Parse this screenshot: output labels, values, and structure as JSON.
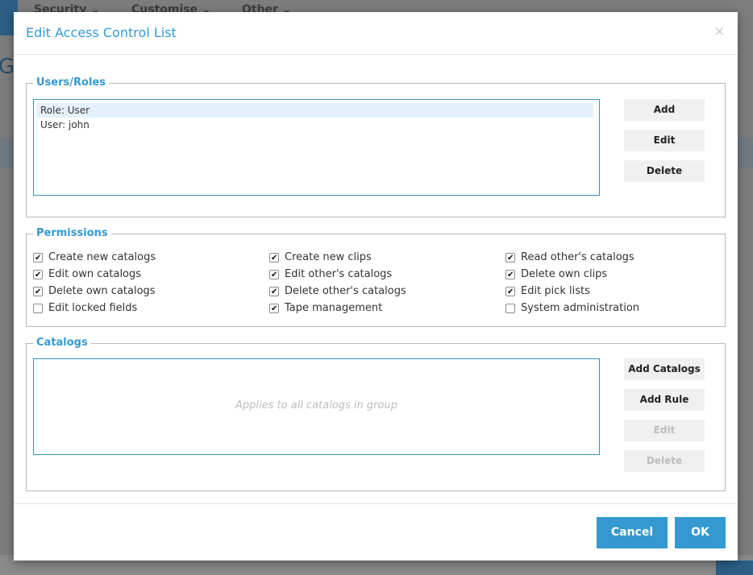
{
  "background": {
    "nav_items": [
      "Security",
      "Customise",
      "Other"
    ],
    "partial_title": "G"
  },
  "dialog": {
    "title": "Edit Access Control List",
    "close_glyph": "×"
  },
  "users_roles": {
    "legend": "Users/Roles",
    "items": [
      "Role: User",
      "User: john"
    ],
    "buttons": {
      "add": "Add",
      "edit": "Edit",
      "delete": "Delete"
    }
  },
  "permissions": {
    "legend": "Permissions",
    "items": [
      {
        "label": "Create new catalogs",
        "checked": true
      },
      {
        "label": "Edit own catalogs",
        "checked": true
      },
      {
        "label": "Delete own catalogs",
        "checked": true
      },
      {
        "label": "Edit locked fields",
        "checked": false
      },
      {
        "label": "Create new clips",
        "checked": true
      },
      {
        "label": "Edit other's catalogs",
        "checked": true
      },
      {
        "label": "Delete other's catalogs",
        "checked": true
      },
      {
        "label": "Tape management",
        "checked": true
      },
      {
        "label": "Read other's catalogs",
        "checked": true
      },
      {
        "label": "Delete own clips",
        "checked": true
      },
      {
        "label": "Edit pick lists",
        "checked": true
      },
      {
        "label": "System administration",
        "checked": false
      }
    ]
  },
  "catalogs": {
    "legend": "Catalogs",
    "placeholder": "Applies to all catalogs in group",
    "buttons": {
      "add_catalogs": "Add Catalogs",
      "add_rule": "Add Rule",
      "edit": "Edit",
      "delete": "Delete"
    }
  },
  "footer": {
    "cancel": "Cancel",
    "ok": "OK"
  },
  "colors": {
    "accent": "#3499d1",
    "selection": "#e4f1fb",
    "button_bg": "#f0f0f0"
  }
}
